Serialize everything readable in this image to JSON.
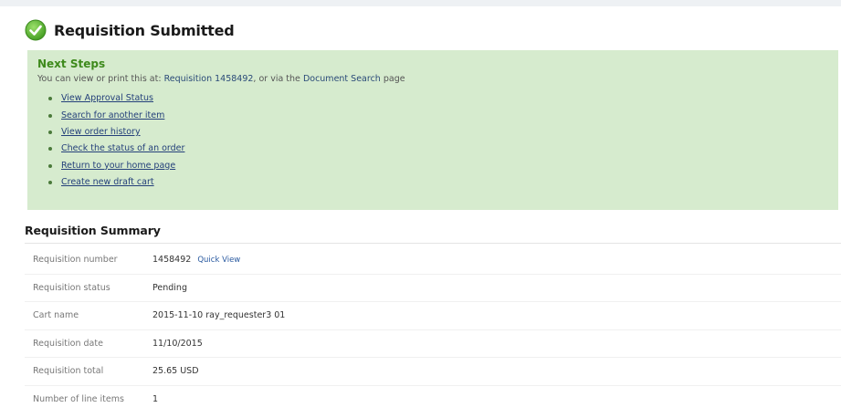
{
  "header": {
    "icon": "check-circle-icon",
    "title": "Requisition Submitted",
    "icon_color": "#5cb030"
  },
  "next_steps": {
    "title": "Next Steps",
    "text_prefix": "You can view or print this at:",
    "requisition_link": "Requisition 1458492",
    "text_middle": ", or via the",
    "document_search_link": "Document Search",
    "text_suffix": "page",
    "links": [
      "View Approval Status",
      "Search for another item",
      "View order history",
      "Check the status of an order",
      "Return to your home page",
      "Create new draft cart"
    ],
    "background_color": "#d6ebce",
    "title_color": "#3e8a1c"
  },
  "summary": {
    "title": "Requisition Summary",
    "rows": [
      {
        "label": "Requisition number",
        "value": "1458492",
        "link": "Quick View"
      },
      {
        "label": "Requisition status",
        "value": "Pending"
      },
      {
        "label": "Cart name",
        "value": "2015-11-10 ray_requester3 01"
      },
      {
        "label": "Requisition date",
        "value": "11/10/2015"
      },
      {
        "label": "Requisition total",
        "value": "25.65 USD"
      },
      {
        "label": "Number of line items",
        "value": "1"
      }
    ]
  }
}
